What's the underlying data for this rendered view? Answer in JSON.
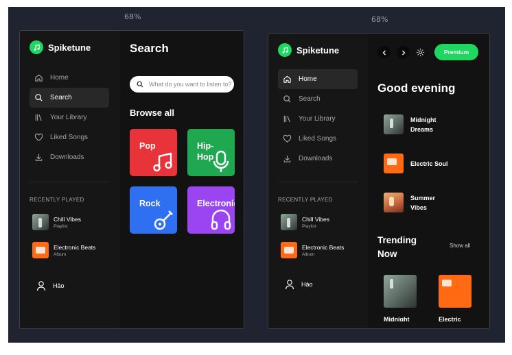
{
  "left": {
    "zoom": "68%",
    "brand": "Spiketune",
    "nav": [
      "Home",
      "Search",
      "Your Library",
      "Liked Songs",
      "Downloads"
    ],
    "recently_played_title": "RECENTLY PLAYED",
    "recent": [
      {
        "title": "Chill Vibes",
        "subtitle": "Playlist"
      },
      {
        "title": "Electronic Beats",
        "subtitle": "Album"
      }
    ],
    "user": "Hảo",
    "page_title": "Search",
    "search_placeholder": "What do you want to listen to?",
    "browse_title": "Browse all",
    "genres": [
      {
        "label": "Pop",
        "color": "#e8333a",
        "icon": "music-note-icon"
      },
      {
        "label": "Hip-Hop",
        "color": "#1fa84f",
        "icon": "microphone-icon"
      },
      {
        "label": "Rock",
        "color": "#2f6ff2",
        "icon": "guitar-icon"
      },
      {
        "label": "Electronic",
        "color": "#9a44f2",
        "icon": "headphones-icon"
      }
    ]
  },
  "right": {
    "zoom": "68%",
    "brand": "Spiketune",
    "nav": [
      "Home",
      "Search",
      "Your Library",
      "Liked Songs",
      "Downloads"
    ],
    "recently_played_title": "RECENTLY PLAYED",
    "recent": [
      {
        "title": "Chill Vibes",
        "subtitle": "Playlist"
      },
      {
        "title": "Electronic Beats",
        "subtitle": "Album"
      }
    ],
    "user": "Hảo",
    "premium_label": "Premium",
    "greeting": "Good evening",
    "quick": [
      "Midnight Dreams",
      "Electric Soul",
      "Summer Vibes"
    ],
    "trending_title": "Trending Now",
    "show_all": "Show all",
    "trending": [
      "Midnight Dreams",
      "Electric Soul"
    ]
  },
  "colors": {
    "accent": "#1ed760",
    "background": "#121212",
    "sidebar": "#161616"
  }
}
